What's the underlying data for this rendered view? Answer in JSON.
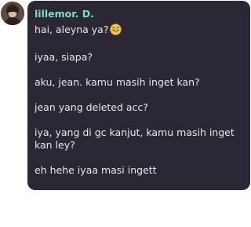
{
  "author": {
    "name": "lillemor. D.",
    "name_color": "#7ee0b8",
    "avatar": "profile-avatar"
  },
  "bubble": {
    "background": "#2b2734",
    "text_color": "#e9e7ee"
  },
  "messages": [
    {
      "text": "hai, aleyna ya?",
      "emoji": "grinning-sweat-emoji"
    },
    {
      "text": "iyaa, siapa?"
    },
    {
      "text": "aku, jean. kamu masih inget kan?"
    },
    {
      "text": "jean yang deleted acc?"
    },
    {
      "text": "iya, yang di gc kanjut, kamu masih inget kan ley?"
    },
    {
      "text": "eh hehe iyaa masi ingett"
    }
  ]
}
